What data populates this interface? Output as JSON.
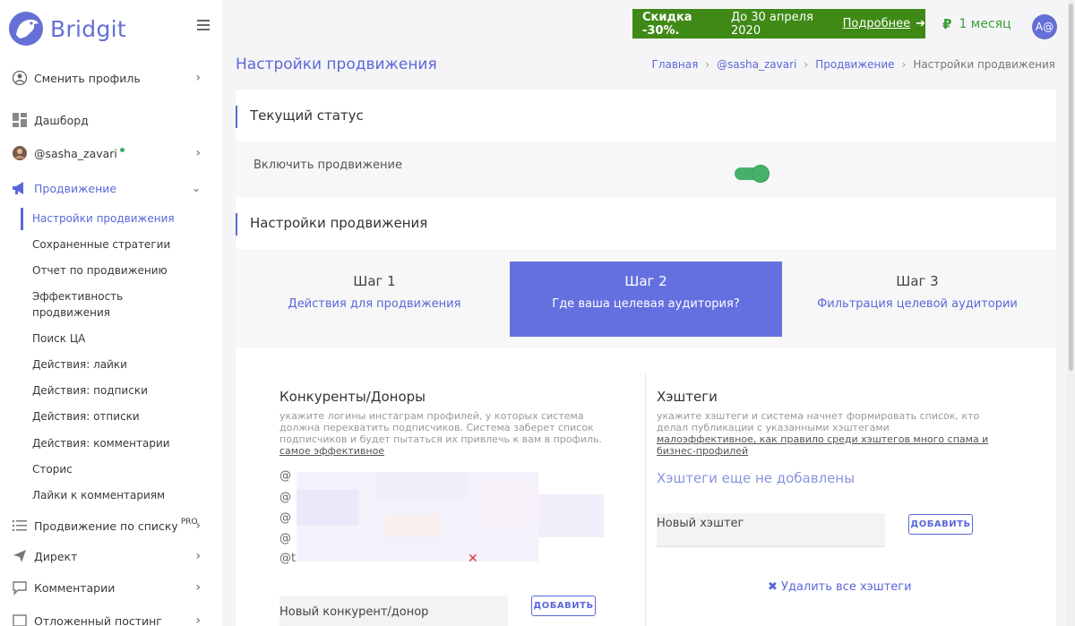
{
  "brand": {
    "name": "Bridgit"
  },
  "header": {
    "promo_bold": "Скидка -30%.",
    "promo_text": "До 30 апреля 2020",
    "promo_link": "Подробнее",
    "promo_arrow": "➔",
    "plan_currency": "₽",
    "plan_label": "1 месяц",
    "avatar": "A@"
  },
  "sidebar": {
    "change_profile": "Сменить профиль",
    "dashboard": "Дашборд",
    "account": "@sasha_zavari",
    "promotion": "Продвижение",
    "sub_items": [
      "Настройки продвижения",
      "Сохраненные стратегии",
      "Отчет по продвижению",
      "Эффективность продвижения",
      "Поиск ЦА",
      "Действия: лайки",
      "Действия: подписки",
      "Действия: отписки",
      "Действия: комментарии",
      "Сторис",
      "Лайки к комментариям"
    ],
    "list_promotion": "Продвижение по списку",
    "pro_badge": "PRO",
    "direct": "Директ",
    "comments": "Комментарии",
    "scheduled": "Отложенный постинг"
  },
  "page": {
    "title": "Настройки продвижения",
    "breadcrumb": [
      "Главная",
      "@sasha_zavari",
      "Продвижение",
      "Настройки продвижения"
    ]
  },
  "status": {
    "heading": "Текущий статус",
    "toggle_label": "Включить продвижение"
  },
  "settings": {
    "heading": "Настройки продвижения",
    "steps": [
      {
        "title": "Шаг 1",
        "subtitle": "Действия для продвижения"
      },
      {
        "title": "Шаг 2",
        "subtitle": "Где ваша целевая аудитория?"
      },
      {
        "title": "Шаг 3",
        "subtitle": "Фильтрация целевой аудитории"
      }
    ]
  },
  "competitors": {
    "title": "Конкуренты/Доноры",
    "hint": "укажите логины инстаграм профилей, у которых система должна перехватить подписчиков. Система заберет список подписчиков и будет пытаться их привлечь к вам в профиль.",
    "hint_link": "самое эффективное",
    "mentions": [
      "@",
      "@",
      "@",
      "@",
      "@t"
    ],
    "remove": "✕",
    "input_placeholder": "Новый конкурент/донор",
    "add": "ДОБАВИТЬ"
  },
  "hashtags": {
    "title": "Хэштеги",
    "hint": "укажите хэштеги и система начнет формировать список, кто делал публикации с указанными хэштегами",
    "hint_link": "малоэффективное, как правило среди хэштегов много спама и бизнес-профилей",
    "empty": "Хэштеги еще не добавлены",
    "input_placeholder": "Новый хэштег",
    "add": "ДОБАВИТЬ",
    "delete_all": "✖ Удалить все хэштеги"
  }
}
